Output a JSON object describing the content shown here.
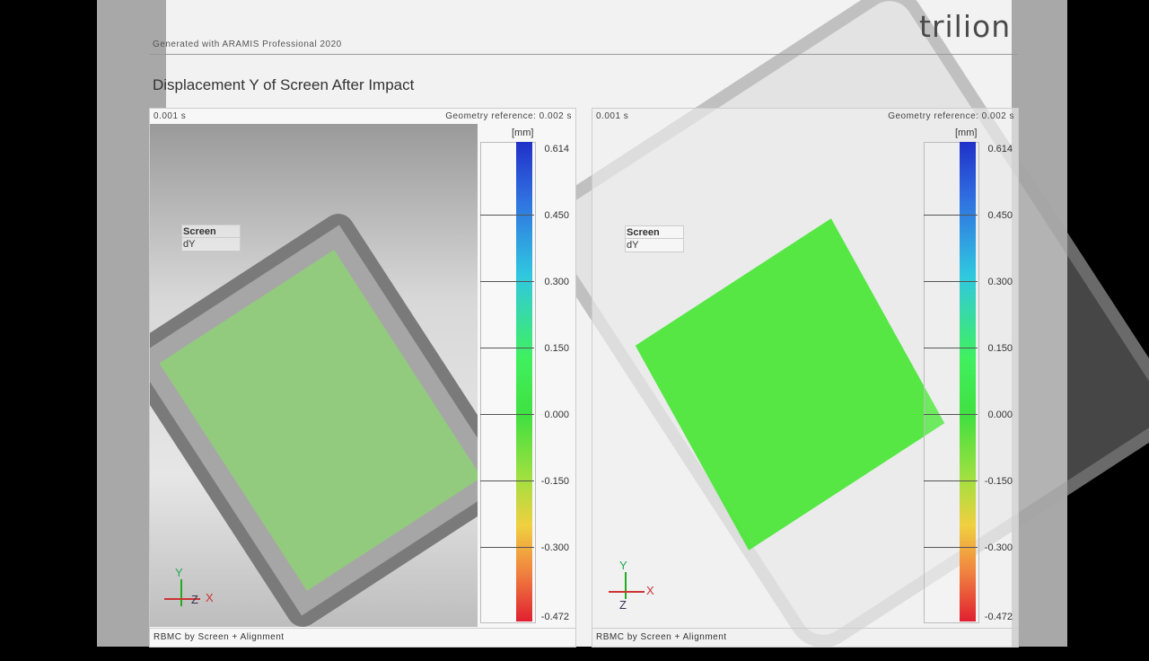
{
  "header": {
    "generated_text": "Generated with ARAMIS Professional 2020",
    "logo": "trilion",
    "title": "Displacement Y of Screen After Impact"
  },
  "panels": [
    {
      "time": "0.001 s",
      "geometry_reference": "Geometry reference: 0.002 s",
      "footer": "RBMC by Screen + Alignment",
      "label": {
        "title": "Screen",
        "value": "dY"
      },
      "axes": {
        "y": "Y",
        "x": "X",
        "z": "Z"
      }
    },
    {
      "time": "0.001 s",
      "geometry_reference": "Geometry reference: 0.002 s",
      "footer": "RBMC by Screen + Alignment",
      "label": {
        "title": "Screen",
        "value": "dY"
      },
      "axes": {
        "y": "Y",
        "x": "X",
        "z": "Z"
      }
    }
  ],
  "legend": {
    "unit": "[mm]",
    "ticks": [
      "0.614",
      "0.450",
      "0.300",
      "0.150",
      "0.000",
      "-0.150",
      "-0.300",
      "-0.472"
    ]
  }
}
